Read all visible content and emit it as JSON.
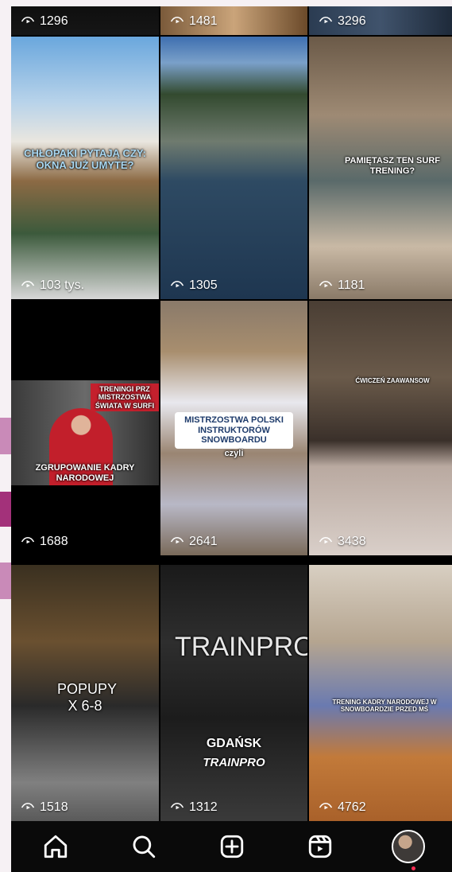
{
  "grid": [
    {
      "views": "1296",
      "overlay": ""
    },
    {
      "views": "1481",
      "overlay": ""
    },
    {
      "views": "3296",
      "overlay": ""
    },
    {
      "views": "103 tys.",
      "overlay": "CHŁOPAKI PYTAJĄ CZY: OKNA JUŻ UMYTE?"
    },
    {
      "views": "1305",
      "overlay": ""
    },
    {
      "views": "1181",
      "overlay": "PAMIĘTASZ TEN SURF TRENING?"
    },
    {
      "views": "1688",
      "overlay": "TRENINGI PRZ MISTRZOSTWA ŚWIATA W SURFI",
      "overlay2": "ZGRUPOWANIE KADRY NARODOWEJ"
    },
    {
      "views": "2641",
      "overlay": "MISTRZOSTWA POLSKI INSTRUKTORÓW SNOWBOARDU",
      "overlay2": "czyli"
    },
    {
      "views": "3438",
      "overlay": "ĆWICZEŃ ZAAWANSOW"
    },
    {
      "views": "1518",
      "overlay": "POPUPY X 6-8"
    },
    {
      "views": "1312",
      "overlay": "GDAŃSK",
      "overlay2": "TRAINPRO",
      "sign": "TRAINPRO"
    },
    {
      "views": "4762",
      "overlay": "TRENING KADRY NARODOWEJ W SNOWBOARDZIE PRZED MŚ"
    }
  ],
  "nav": [
    {
      "name": "home",
      "icon": "home-icon"
    },
    {
      "name": "search",
      "icon": "search-icon"
    },
    {
      "name": "create",
      "icon": "plus-square-icon"
    },
    {
      "name": "reels",
      "icon": "reels-icon"
    },
    {
      "name": "profile",
      "icon": "avatar"
    }
  ],
  "colors": {
    "accent": "#c98ab8",
    "accent_dark": "#a3317a",
    "nav_bg": "#0a0a0a"
  }
}
